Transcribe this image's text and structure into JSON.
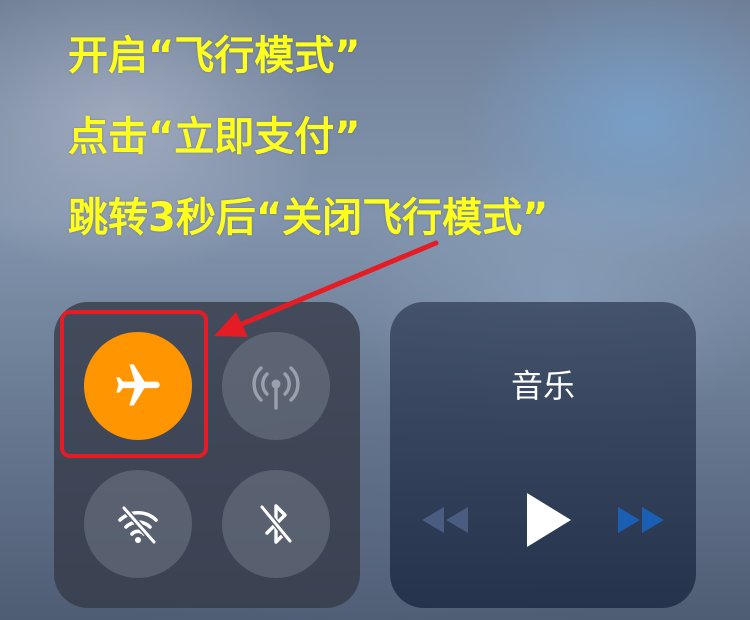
{
  "instructions": [
    "开启“飞行模式”",
    "点击“立即支付”",
    "跳转3秒后“关闭飞行模式”"
  ],
  "control_center": {
    "toggles": [
      {
        "icon": "airplane-icon",
        "state": "on",
        "color": "#ff9500"
      },
      {
        "icon": "cellular-antenna-icon",
        "state": "off"
      },
      {
        "icon": "wifi-off-icon",
        "state": "off"
      },
      {
        "icon": "bluetooth-off-icon",
        "state": "off"
      }
    ],
    "music": {
      "title": "音乐",
      "controls": [
        "rewind-icon",
        "play-icon",
        "fast-forward-icon"
      ]
    }
  },
  "annotation": {
    "highlight_color": "#e51c23",
    "arrow_color": "#e51c23"
  }
}
